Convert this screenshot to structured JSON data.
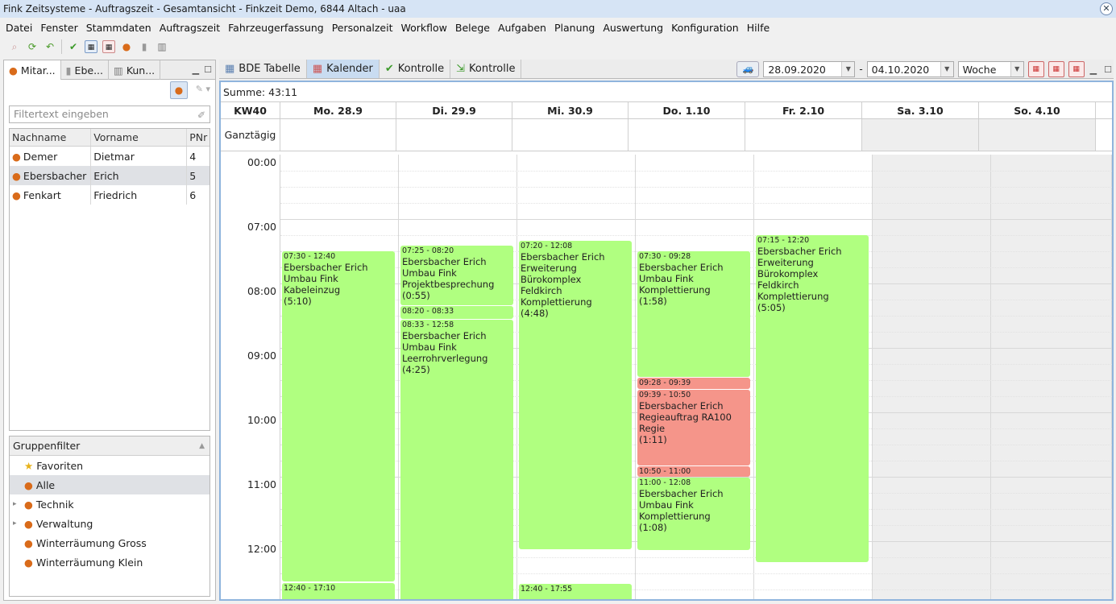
{
  "window": {
    "title": "Fink Zeitsysteme - Auftragszeit - Gesamtansicht - Finkzeit Demo, 6844 Altach - uaa",
    "close": "✕"
  },
  "menu": [
    "Datei",
    "Fenster",
    "Stammdaten",
    "Auftragszeit",
    "Fahrzeugerfassung",
    "Personalzeit",
    "Workflow",
    "Belege",
    "Aufgaben",
    "Planung",
    "Auswertung",
    "Konfiguration",
    "Hilfe"
  ],
  "left": {
    "tabs": [
      "Mitar...",
      "Ebe...",
      "Kun..."
    ],
    "filter_placeholder": "Filtertext eingeben",
    "columns": [
      "Nachname",
      "Vorname",
      "PNr"
    ],
    "rows": [
      {
        "nachname": "Demer",
        "vorname": "Dietmar",
        "pnr": "4"
      },
      {
        "nachname": "Ebersbacher",
        "vorname": "Erich",
        "pnr": "5"
      },
      {
        "nachname": "Fenkart",
        "vorname": "Friedrich",
        "pnr": "6"
      }
    ],
    "groups_title": "Gruppenfilter",
    "groups": [
      "Favoriten",
      "Alle",
      "Technik",
      "Verwaltung",
      "Winterräumung Gross",
      "Winterräumung Klein"
    ]
  },
  "right": {
    "tabs": [
      "BDE Tabelle",
      "Kalender",
      "Kontrolle",
      "Kontrolle"
    ],
    "date_from": "28.09.2020",
    "date_sep": "-",
    "date_to": "04.10.2020",
    "view": "Woche",
    "summe_label": "Summe:",
    "summe_value": "43:11",
    "week": "KW40",
    "days": [
      "Mo. 28.9",
      "Di. 29.9",
      "Mi. 30.9",
      "Do. 1.10",
      "Fr. 2.10",
      "Sa. 3.10",
      "So. 4.10"
    ],
    "allday_label": "Ganztägig",
    "times": [
      "00:00",
      "07:00",
      "08:00",
      "09:00",
      "10:00",
      "11:00",
      "12:00"
    ],
    "events": {
      "mo1": {
        "time": "07:30 - 12:40",
        "l1": "Ebersbacher Erich",
        "l2": "Umbau Fink",
        "l3": "Kabeleinzug",
        "l4": "(5:10)"
      },
      "mo2": {
        "time": "12:40 - 17:10"
      },
      "di1": {
        "time": "07:25 - 08:20",
        "l1": "Ebersbacher Erich",
        "l2": "Umbau Fink",
        "l3": "Projektbesprechung",
        "l4": "(0:55)"
      },
      "di2": {
        "time": "08:20 - 08:33"
      },
      "di3": {
        "time": "08:33 - 12:58",
        "l1": "Ebersbacher Erich",
        "l2": "Umbau Fink",
        "l3": "Leerrohrverlegung",
        "l4": "(4:25)"
      },
      "mi1": {
        "time": "07:20 - 12:08",
        "l1": "Ebersbacher Erich",
        "l2": "Erweiterung Bürokomplex",
        "l3": "Feldkirch",
        "l4": "Komplettierung",
        "l5": "(4:48)"
      },
      "mi2": {
        "time": "12:40 - 17:55"
      },
      "do1": {
        "time": "07:30 - 09:28",
        "l1": "Ebersbacher Erich",
        "l2": "Umbau Fink",
        "l3": "Komplettierung",
        "l4": "(1:58)"
      },
      "do2": {
        "time": "09:28 - 09:39"
      },
      "do3": {
        "time": "09:39 - 10:50",
        "l1": "Ebersbacher Erich",
        "l2": "Regieauftrag RA100",
        "l3": "Regie",
        "l4": "(1:11)"
      },
      "do4": {
        "time": "10:50 - 11:00"
      },
      "do5": {
        "time": "11:00 - 12:08",
        "l1": "Ebersbacher Erich",
        "l2": "Umbau Fink",
        "l3": "Komplettierung",
        "l4": "(1:08)"
      },
      "fr1": {
        "time": "07:15 - 12:20",
        "l1": "Ebersbacher Erich",
        "l2": "Erweiterung Bürokomplex",
        "l3": "Feldkirch",
        "l4": "Komplettierung",
        "l5": "(5:05)"
      }
    }
  },
  "colors": {
    "event_green": "#b0ff80",
    "event_red": "#f5958a",
    "accent": "#8fb4dd"
  }
}
